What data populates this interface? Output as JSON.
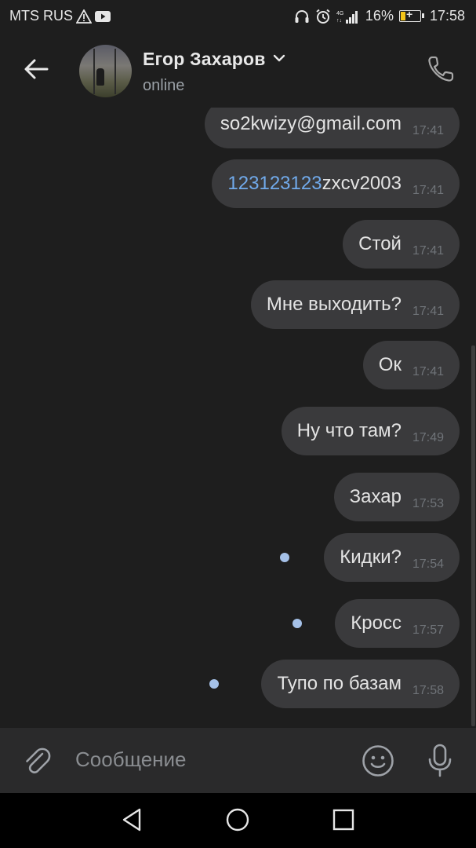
{
  "status_bar": {
    "carrier": "MTS RUS",
    "battery_percent": "16%",
    "time": "17:58",
    "icons": [
      "warning-icon",
      "youtube-icon",
      "headphones-icon",
      "alarm-icon",
      "signal-icon",
      "battery-icon"
    ]
  },
  "header": {
    "contact_name": "Егор Захаров",
    "presence": "online",
    "icons": [
      "back-arrow-icon",
      "chevron-down-icon",
      "phone-icon"
    ]
  },
  "messages": [
    {
      "text": "so2kwizy@gmail.com",
      "time": "17:41",
      "link": true
    },
    {
      "link_part": "123123123",
      "text": "zxcv2003",
      "time": "17:41"
    },
    {
      "text": "Стой",
      "time": "17:41"
    },
    {
      "text": "Мне выходить?",
      "time": "17:41"
    },
    {
      "text": "Ок",
      "time": "17:41"
    },
    {
      "text": "Ну что там?",
      "time": "17:49"
    },
    {
      "text": "Захар",
      "time": "17:53"
    },
    {
      "text": "Кидки?",
      "time": "17:54",
      "unread": true
    },
    {
      "text": "Кросс",
      "time": "17:57",
      "unread": true
    },
    {
      "text": "Тупо по базам",
      "time": "17:58",
      "unread": true
    }
  ],
  "composer": {
    "placeholder": "Сообщение",
    "icons": [
      "paperclip-icon",
      "emoji-icon",
      "microphone-icon"
    ]
  },
  "navbar": {
    "icons": [
      "nav-back-icon",
      "nav-home-icon",
      "nav-recents-icon"
    ]
  },
  "colors": {
    "background": "#1e1e1e",
    "bubble": "#3a3a3c",
    "link": "#71aaeb",
    "unread_dot": "#a5c1e8",
    "composer": "#2a2a2b"
  }
}
